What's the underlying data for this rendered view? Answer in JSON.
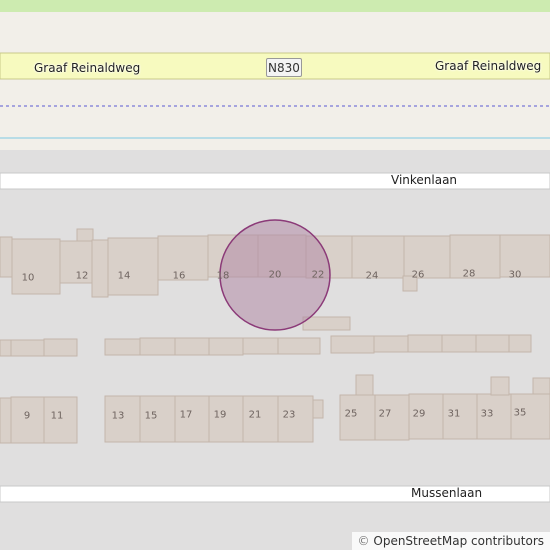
{
  "map": {
    "roads": {
      "main_road_left": "Graaf Reinaldweg",
      "main_road_right": "Graaf Reinaldweg",
      "route_ref": "N830",
      "street_top": "Vinkenlaan",
      "street_bottom": "Mussenlaan"
    },
    "house_numbers_top": [
      "10",
      "12",
      "14",
      "16",
      "18",
      "20",
      "22",
      "24",
      "26",
      "28",
      "30"
    ],
    "house_numbers_bottom": [
      "9",
      "11",
      "13",
      "15",
      "17",
      "19",
      "21",
      "23",
      "25",
      "27",
      "29",
      "31",
      "33",
      "35"
    ],
    "attribution": {
      "symbol": "©",
      "text": "OpenStreetMap contributors"
    },
    "colors": {
      "background": "#f2efe9",
      "residential": "#e0dfdf",
      "building": "#d9d0c9",
      "building_outline": "#c4b6ab",
      "primary_road": "#fcd6a4",
      "tertiary_road": "#f7fabf",
      "park": "#cdebb0",
      "boundary": "#1a1acc",
      "waterway": "#a5d5e6",
      "marker_fill": "#b28aa6",
      "marker_stroke": "#8b3a78"
    },
    "icons": {
      "attribution": "copyright-symbol"
    }
  }
}
